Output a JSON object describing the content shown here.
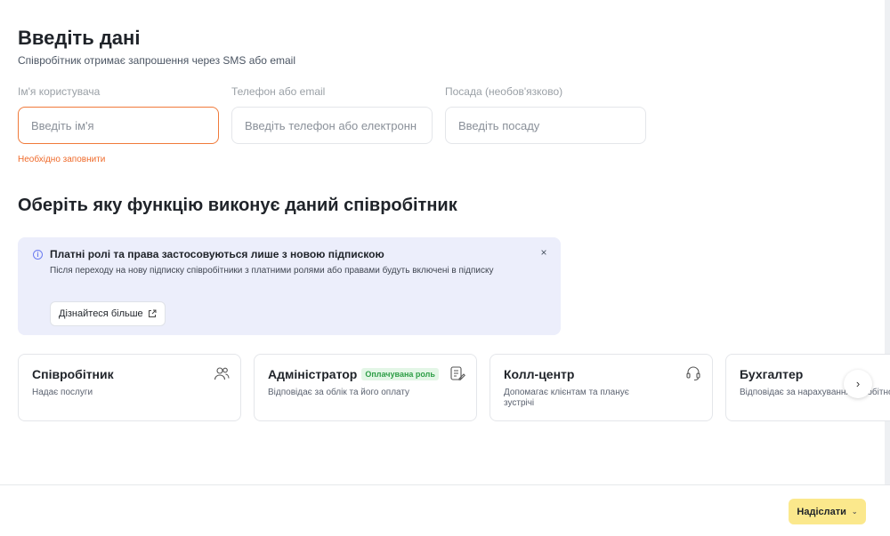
{
  "header": {
    "title": "Введіть дані",
    "subtitle": "Співробітник отримає запрошення через SMS або email"
  },
  "form": {
    "name": {
      "label": "Ім'я користувача",
      "placeholder": "Введіть ім'я",
      "value": "",
      "error": "Необхідно заповнити"
    },
    "contact": {
      "label": "Телефон або email",
      "placeholder": "Введіть телефон або електронн",
      "value": ""
    },
    "position": {
      "label": "Посада (необов'язково)",
      "placeholder": "Введіть посаду",
      "value": ""
    }
  },
  "roles_section": {
    "title": "Оберіть яку функцію виконує даний співробітник"
  },
  "notice": {
    "icon": "info-icon",
    "title": "Платні ролі та права застосовуються лише з новою підпискою",
    "body": "Після переходу на нову підписку співробітники з платними ролями або правами будуть включені в підписку",
    "learn_more": "Дізнайтеся більше",
    "close": "×"
  },
  "roles": [
    {
      "title": "Співробітник",
      "badge": "",
      "description": "Надає послуги",
      "icon": "users-icon"
    },
    {
      "title": "Адміністратор",
      "badge": "Оплачувана роль",
      "description": "Відповідає за облік та його оплату",
      "icon": "clipboard-edit-icon"
    },
    {
      "title": "Колл-центр",
      "badge": "",
      "description": "Допомагає клієнтам та планує зустрічі",
      "icon": "headset-icon"
    },
    {
      "title": "Бухгалтер",
      "badge": "",
      "description": "Відповідає за нарахування заробітної плати",
      "icon": ""
    }
  ],
  "carousel": {
    "next_label": "›"
  },
  "footer": {
    "submit_label": "Надіслати",
    "submit_chevron": "⌄"
  },
  "colors": {
    "error": "#ef6a2a",
    "notice_bg": "#eceefb",
    "badge_bg": "#e3f6e6",
    "badge_text": "#2e9e47",
    "submit_bg": "#fbe88c"
  }
}
